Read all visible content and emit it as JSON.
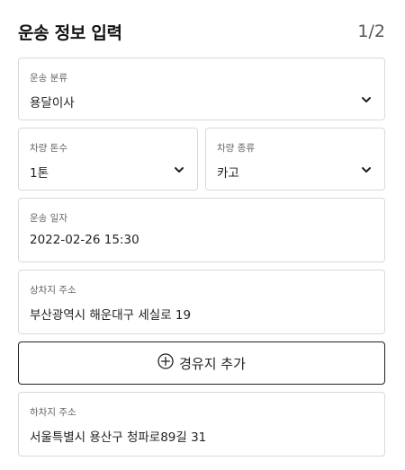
{
  "header": {
    "title": "운송 정보 입력",
    "step": "1/2"
  },
  "fields": {
    "transport_type": {
      "label": "운송 분류",
      "value": "용달이사"
    },
    "vehicle_tonnage": {
      "label": "차량 톤수",
      "value": "1톤"
    },
    "vehicle_type": {
      "label": "차량 종류",
      "value": "카고"
    },
    "transport_date": {
      "label": "운송 일자",
      "value": "2022-02-26 15:30"
    },
    "loading_address": {
      "label": "상차지 주소",
      "value": "부산광역시 해운대구 세실로 19"
    },
    "unloading_address": {
      "label": "하차지 주소",
      "value": "서울특별시 용산구 청파로89길 31"
    }
  },
  "add_waypoint": {
    "label": "경유지 추가",
    "icon": "plus-circle-icon"
  }
}
